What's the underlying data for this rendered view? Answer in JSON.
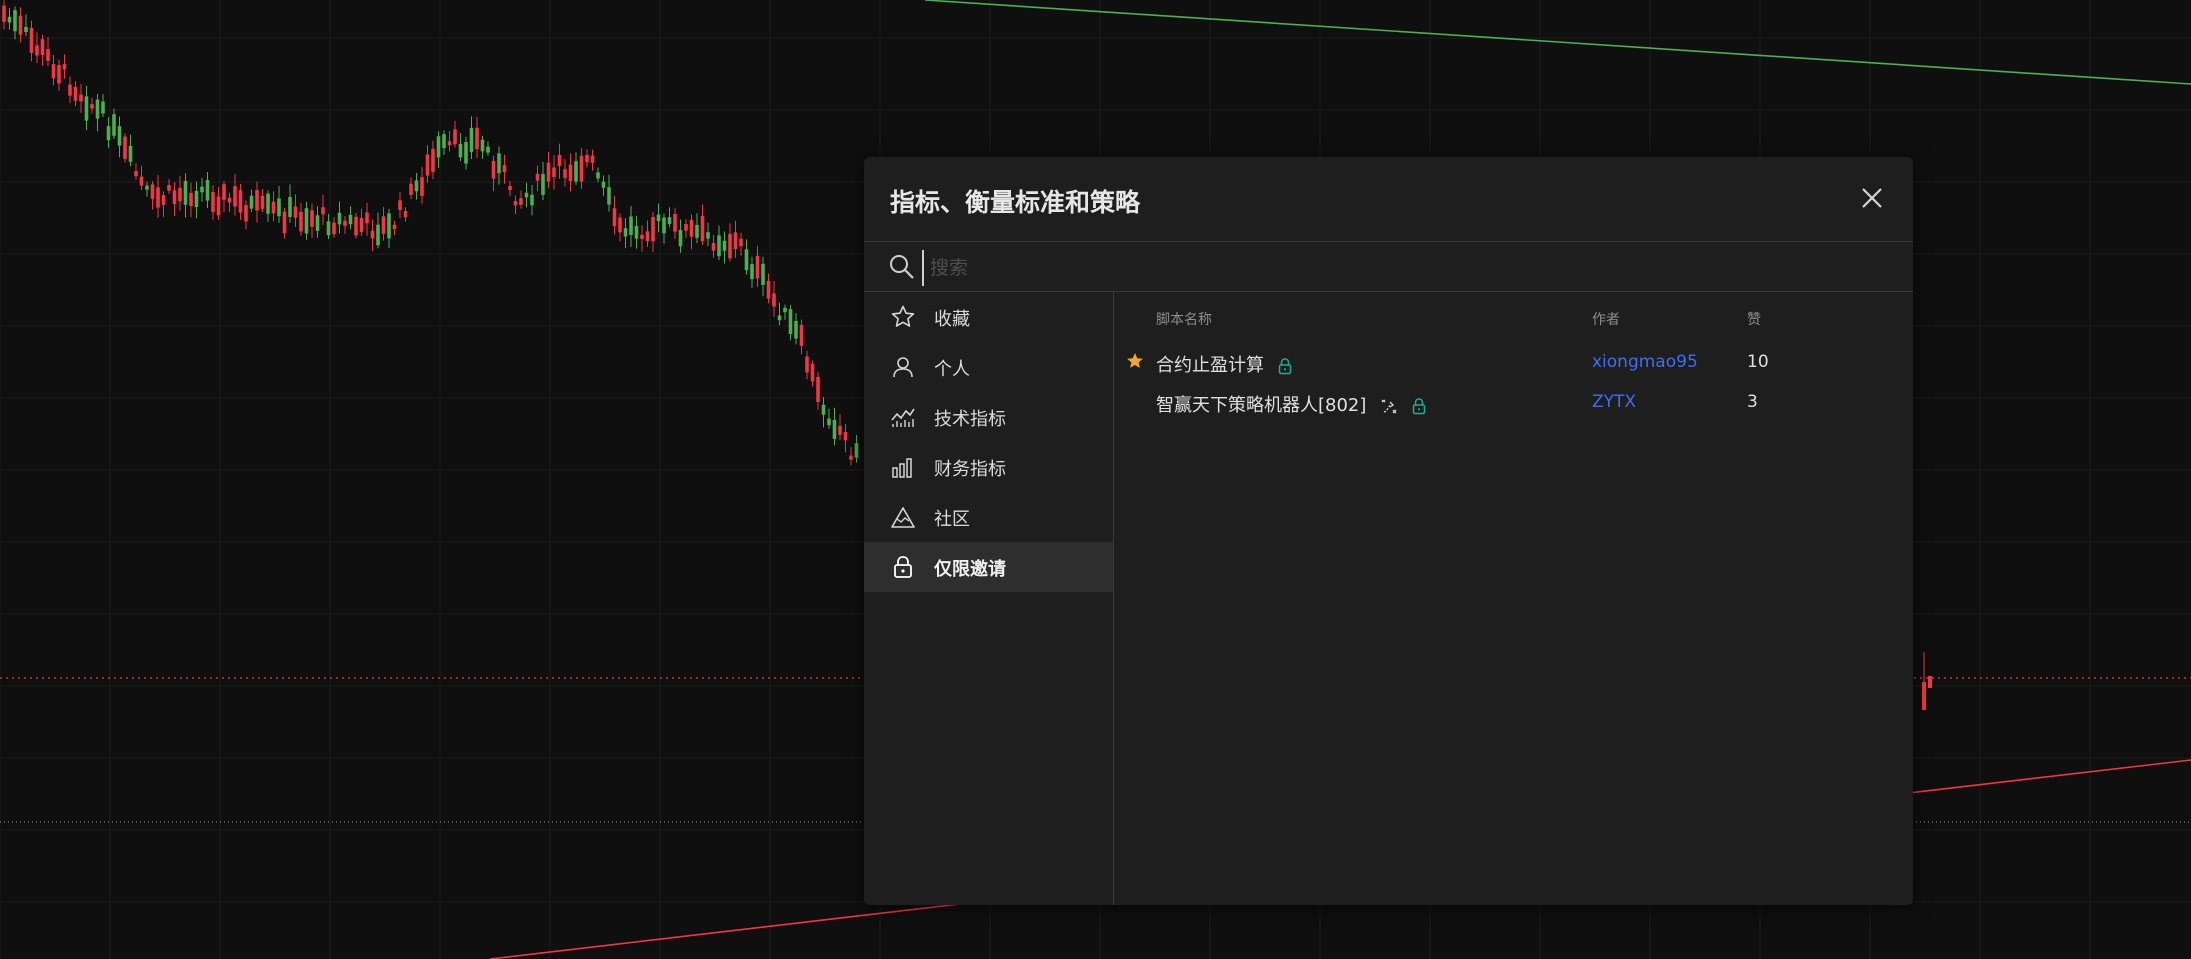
{
  "dialog": {
    "title": "指标、衡量标准和策略",
    "close_icon": "close-icon"
  },
  "search": {
    "icon": "search-icon",
    "placeholder": "搜索",
    "value": ""
  },
  "sidebar": {
    "items": [
      {
        "label": "收藏",
        "icon": "star-outline-icon",
        "active": false
      },
      {
        "label": "个人",
        "icon": "user-icon",
        "active": false
      },
      {
        "label": "技术指标",
        "icon": "line-chart-icon",
        "active": false
      },
      {
        "label": "财务指标",
        "icon": "bar-chart-icon",
        "active": false
      },
      {
        "label": "社区",
        "icon": "mountain-icon",
        "active": false
      },
      {
        "label": "仅限邀请",
        "icon": "lock-icon",
        "active": true
      }
    ]
  },
  "table": {
    "columns": {
      "name": "脚本名称",
      "author": "作者",
      "likes": "赞"
    },
    "rows": [
      {
        "favorite": true,
        "name": "合约止盈计算",
        "strategy": false,
        "locked": true,
        "author": "xiongmao95",
        "likes": "10"
      },
      {
        "favorite": false,
        "name": "智赢天下策略机器人[802]",
        "strategy": true,
        "locked": true,
        "author": "ZYTX",
        "likes": "3"
      }
    ]
  },
  "colors": {
    "bull": "#4caf50",
    "bear": "#f23645",
    "link": "#3d6ff5",
    "favorite_star": "#f5a623",
    "lock": "#22ab94",
    "dialog_bg": "#1e1e1e",
    "page_bg": "#0f0f0f"
  }
}
